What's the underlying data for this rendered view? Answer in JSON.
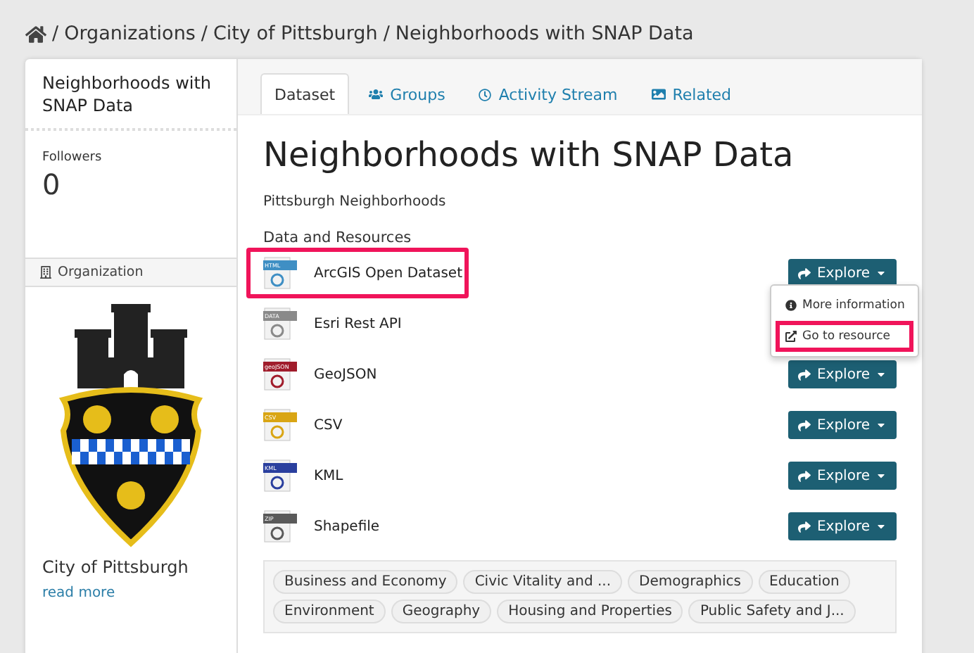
{
  "breadcrumb": [
    {
      "separator": "/",
      "label": "Organizations"
    },
    {
      "separator": "/",
      "label": "City of Pittsburgh"
    },
    {
      "separator": "/",
      "label": "Neighborhoods with SNAP Data"
    }
  ],
  "sidebar": {
    "title": "Neighborhoods with SNAP Data",
    "followers_label": "Followers",
    "followers_count": "0",
    "section_title": "Organization",
    "org_name": "City of Pittsburgh",
    "read_more": "read more"
  },
  "tabs": [
    {
      "label": "Dataset",
      "selected": true,
      "kind": "plain"
    },
    {
      "label": "Groups",
      "selected": false,
      "kind": "groups"
    },
    {
      "label": "Activity Stream",
      "selected": false,
      "kind": "activity"
    },
    {
      "label": "Related",
      "selected": false,
      "kind": "related"
    }
  ],
  "title": "Neighborhoods with SNAP Data",
  "subtitle": "Pittsburgh Neighborhoods",
  "resources_heading": "Data and Resources",
  "resources": [
    {
      "name": "ArcGIS Open Dataset",
      "format": "HTML",
      "color": "#3f8fc4",
      "button": "Explore",
      "highlighted": true
    },
    {
      "name": "Esri Rest API",
      "format": "DATA",
      "color": "#8a8a8a",
      "highlighted": false
    },
    {
      "name": "GeoJSON",
      "format": "geoJSON",
      "color": "#a01c2b",
      "button": "Explore",
      "highlighted": false
    },
    {
      "name": "CSV",
      "format": "CSV",
      "color": "#d9a514",
      "button": "Explore",
      "highlighted": false
    },
    {
      "name": "KML",
      "format": "KML",
      "color": "#2a3f9e",
      "button": "Explore",
      "highlighted": false
    },
    {
      "name": "Shapefile",
      "format": "ZIP",
      "color": "#5a5a5a",
      "button": "Explore",
      "highlighted": false
    }
  ],
  "explore_menu": [
    {
      "label": "More information",
      "kind": "info",
      "highlighted": false
    },
    {
      "label": "Go to resource",
      "kind": "external",
      "highlighted": true
    }
  ],
  "tags": [
    "Business and Economy",
    "Civic Vitality and ...",
    "Demographics",
    "Education",
    "Environment",
    "Geography",
    "Housing and Properties",
    "Public Safety and J..."
  ]
}
